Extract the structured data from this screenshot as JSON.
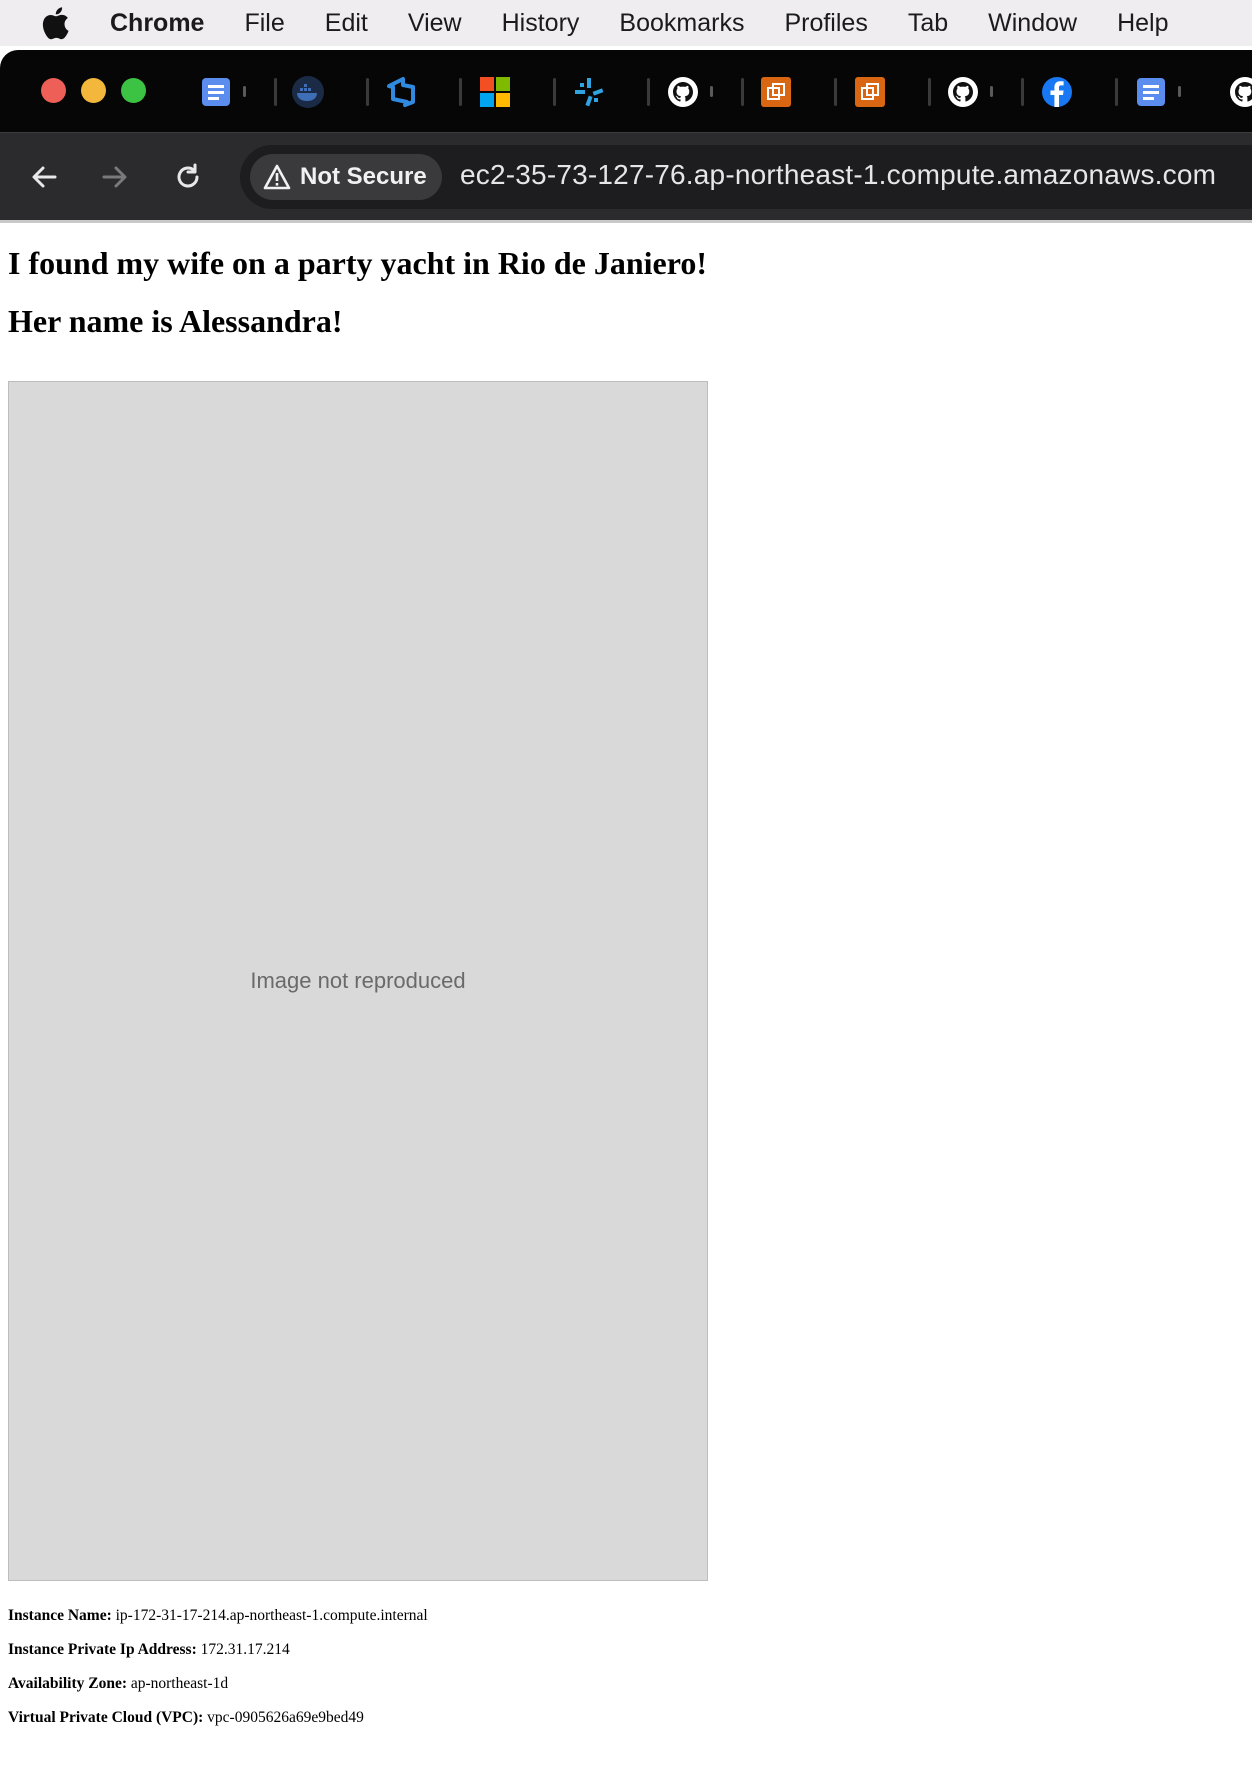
{
  "menubar": {
    "app_name": "Chrome",
    "items": [
      "File",
      "Edit",
      "View",
      "History",
      "Bookmarks",
      "Profiles",
      "Tab",
      "Window",
      "Help"
    ]
  },
  "tabs": [
    {
      "icon": "google-docs-icon"
    },
    {
      "icon": "docker-icon"
    },
    {
      "icon": "azure-devops-icon"
    },
    {
      "icon": "microsoft-icon"
    },
    {
      "icon": "pinwheel-icon"
    },
    {
      "icon": "github-icon"
    },
    {
      "icon": "aws-icon"
    },
    {
      "icon": "aws-icon"
    },
    {
      "icon": "github-icon"
    },
    {
      "icon": "facebook-icon"
    },
    {
      "icon": "google-docs-icon"
    },
    {
      "icon": "github-icon"
    }
  ],
  "toolbar": {
    "security_label": "Not Secure",
    "url": "ec2-35-73-127-76.ap-northeast-1.compute.amazonaws.com"
  },
  "page": {
    "heading_1": "I found my wife on a party yacht in Rio de Janiero!",
    "heading_2": "Her name is Alessandra!",
    "photo_placeholder": "Image not reproduced",
    "info": [
      {
        "label": "Instance Name:",
        "value": "ip-172-31-17-214.ap-northeast-1.compute.internal"
      },
      {
        "label": "Instance Private Ip Address:",
        "value": "172.31.17.214"
      },
      {
        "label": "Availability Zone:",
        "value": "ap-northeast-1d"
      },
      {
        "label": "Virtual Private Cloud (VPC):",
        "value": "vpc-0905626a69e9bed49"
      }
    ]
  },
  "colors": {
    "close": "#ed5f57",
    "minimize": "#f3b73b",
    "maximize": "#3cc344",
    "tabstrip": "#060606",
    "toolbar": "#2b2b2d"
  }
}
